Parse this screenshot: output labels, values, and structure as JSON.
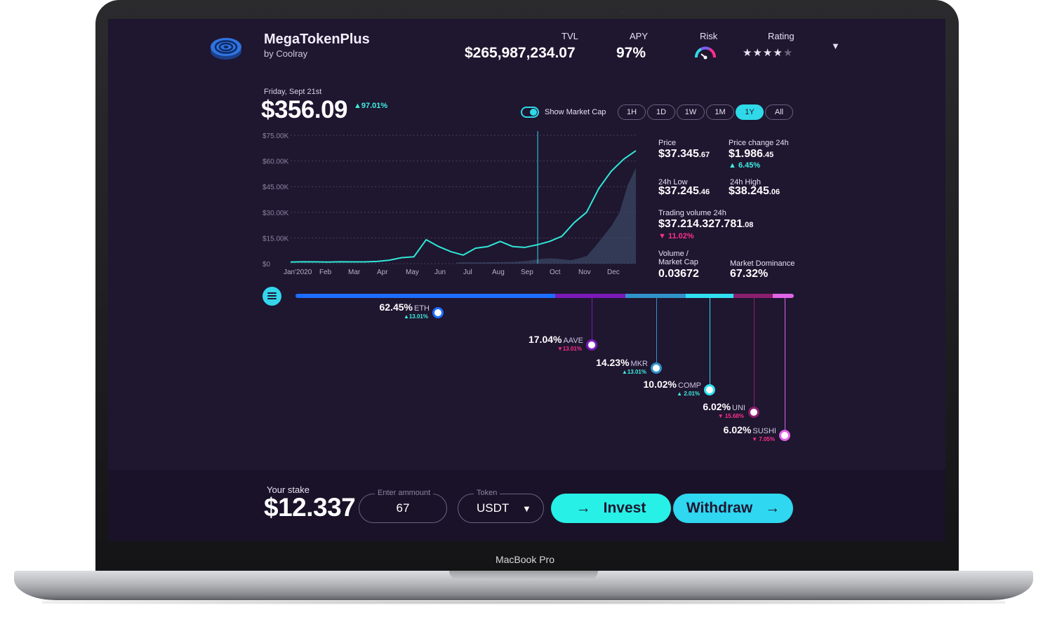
{
  "device": {
    "label": "MacBook Pro"
  },
  "app": {
    "name": "MegaTokenPlus",
    "author": "by Coolray",
    "tvl_label": "TVL",
    "tvl_value": "$265,987,234.07",
    "apy_label": "APY",
    "apy_value": "97%",
    "risk_label": "Risk",
    "rating_label": "Rating",
    "rating_stars": 4,
    "rating_max": 5,
    "dropdown_icon": "▼"
  },
  "price": {
    "date": "Friday, Sept 21st",
    "value": "$356.09",
    "change": "▲97.01%"
  },
  "controls": {
    "show_market_cap_label": "Show Market Cap",
    "show_market_cap_on": true,
    "ranges": [
      "1H",
      "1D",
      "1W",
      "1M",
      "1Y",
      "All"
    ],
    "active_range": "1Y"
  },
  "chart_data": {
    "type": "line",
    "y_ticks": [
      "$75.00K",
      "$60.00K",
      "$45.00K",
      "$30.00K",
      "$15.00K",
      "$0"
    ],
    "ylim": [
      0,
      75000
    ],
    "x_ticks": [
      "Jan'2020",
      "Feb",
      "Mar",
      "Apr",
      "May",
      "Jun",
      "Jul",
      "Aug",
      "Sep",
      "Oct",
      "Nov",
      "Dec"
    ],
    "grid": true,
    "cursor_month_index": 8.1,
    "series": [
      {
        "values": [
          900,
          1100,
          1000,
          900,
          1100,
          1000,
          1000,
          1300,
          2000,
          3500,
          4000,
          14000,
          10000,
          7000,
          5000,
          9000,
          10000,
          13000,
          10000,
          9500,
          11000,
          13000,
          16000,
          24000,
          30000,
          44000,
          54000,
          61000,
          66000
        ]
      }
    ],
    "volume": [
      600,
      800,
      700,
      700,
      800,
      800,
      900,
      1000,
      1300,
      1800,
      2500,
      3000,
      3000,
      2500,
      2000,
      3000,
      4500,
      10000,
      16000,
      22000,
      30000,
      46000,
      56000
    ]
  },
  "stats": {
    "price_label": "Price",
    "price_main": "$37.345",
    "price_cents": ".67",
    "change24_label": "Price change 24h",
    "change24_main": "$1.986",
    "change24_cents": ".45",
    "change24_pct": "▲ 6.45%",
    "low_label": "24h Low",
    "low_main": "$37.245",
    "low_cents": ".46",
    "high_label": "24h High",
    "high_main": "$38.245",
    "high_cents": ".06",
    "volume_label": "Trading volume 24h",
    "volume_main": "$37.214.327.781",
    "volume_cents": ".08",
    "volume_pct": "▼ 11.02%",
    "vol_mcap_label_1": "Volume /",
    "vol_mcap_label_2": "Market Cap",
    "vol_mcap_value": "0.03672",
    "dominance_label": "Market Dominance",
    "dominance_value": "67.32%"
  },
  "allocation": [
    {
      "pct": "62.45%",
      "symbol": "ETH",
      "change": "▲13.01%",
      "direction": "up",
      "color": "#1d6dff",
      "share": 0.5211
    },
    {
      "pct": "17.04%",
      "symbol": "AAVE",
      "change": "▼13.01%",
      "direction": "down",
      "color": "#7a1ab8",
      "share": 0.1408
    },
    {
      "pct": "14.23%",
      "symbol": "MKR",
      "change": "▲13.01%",
      "direction": "up",
      "color": "#2f92c9",
      "share": 0.1211
    },
    {
      "pct": "10.02%",
      "symbol": "COMP",
      "change": "▲ 2.01%",
      "direction": "up",
      "color": "#2fe0f0",
      "share": 0.0958
    },
    {
      "pct": "6.02%",
      "symbol": "UNI",
      "change": "▼ 15.68%",
      "direction": "down",
      "color": "#8a1f6e",
      "share": 0.0789
    },
    {
      "pct": "6.02%",
      "symbol": "SUSHI",
      "change": "▼ 7.05%",
      "direction": "down",
      "color": "#e064e6",
      "share": 0.0423
    }
  ],
  "stake": {
    "label": "Your stake",
    "value": "$12.337",
    "amount_legend": "Enter ammount",
    "amount_value": "67",
    "token_legend": "Token",
    "token_value": "USDT",
    "token_dropdown_icon": "▼",
    "invest_label": "Invest",
    "withdraw_label": "Withdraw",
    "arrow_icon": "→"
  },
  "colors": {
    "background": "#1f1630",
    "footer": "#1a1228",
    "accent": "#2fd9e8",
    "up": "#3df0e0",
    "down": "#ff2f8e"
  }
}
